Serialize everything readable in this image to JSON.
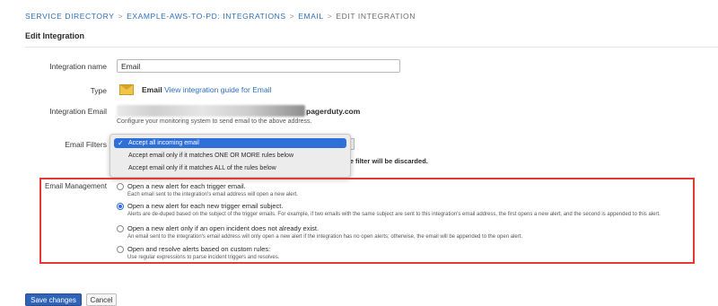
{
  "breadcrumb": {
    "items": [
      "SERVICE DIRECTORY",
      "EXAMPLE-AWS-TO-PD: INTEGRATIONS",
      "EMAIL",
      "EDIT INTEGRATION"
    ],
    "separator": ">"
  },
  "page_title": "Edit Integration",
  "form": {
    "integration_name": {
      "label": "Integration name",
      "value": "Email"
    },
    "type": {
      "label": "Type",
      "icon": "envelope-icon",
      "name": "Email",
      "guide_link": "View integration guide for Email"
    },
    "integration_email": {
      "label": "Integration Email",
      "domain": "pagerduty.com",
      "help": "Configure your monitoring system to send email to the above address."
    },
    "email_filters": {
      "label": "Email Filters",
      "options": [
        "Accept all incoming email",
        "Accept email only if it matches ONE OR MORE rules below",
        "Accept email only if it matches ALL of the rules below"
      ],
      "selected_index": 0,
      "discard_note": "n the filter will be discarded."
    },
    "email_management": {
      "label": "Email Management",
      "selected_index": 1,
      "options": [
        {
          "title": "Open a new alert for each trigger email.",
          "desc": "Each email sent to the integration's email address will open a new alert."
        },
        {
          "title": "Open a new alert for each new trigger email subject.",
          "desc": "Alerts are de-duped based on the subject of the trigger emails. For example, if two emails with the same subject are sent to this integration's email address, the first opens a new alert, and the second is appended to this alert."
        },
        {
          "title": "Open a new alert only if an open incident does not already exist.",
          "desc": "An email sent to the integration's email address will only open a new alert if the integration has no open alerts; otherwise, the email will be appended to the open alert."
        },
        {
          "title": "Open and resolve alerts based on custom rules:",
          "desc": "Use regular expressions to parse incident triggers and resolves."
        }
      ]
    }
  },
  "buttons": {
    "save": "Save changes",
    "cancel": "Cancel"
  },
  "colors": {
    "accent": "#2f6fd8",
    "highlight_border": "#e23b32",
    "link": "#2d6fc0"
  }
}
